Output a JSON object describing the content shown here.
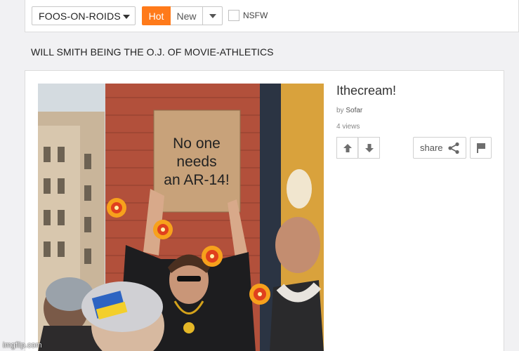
{
  "toolbar": {
    "stream_label": "FOOS-ON-ROIDS",
    "sort_hot": "Hot",
    "sort_new": "New",
    "nsfw_label": "NSFW",
    "accent_color": "#ff7a1a"
  },
  "headline": "WILL SMITH BEING THE O.J. OF MOVIE-ATHLETICS",
  "post": {
    "title": "Ithecream!",
    "by_label": "by",
    "author": "Sofar",
    "views": "4 views",
    "share_label": "share",
    "image": {
      "sign_line1": "No one",
      "sign_line2": "needs",
      "sign_line3": "an AR-14!"
    }
  },
  "watermark": "imgflip.com",
  "icons": [
    "chevron-down-icon",
    "upvote-arrow-icon",
    "downvote-arrow-icon",
    "share-icon",
    "flag-icon",
    "explosion-icon"
  ]
}
